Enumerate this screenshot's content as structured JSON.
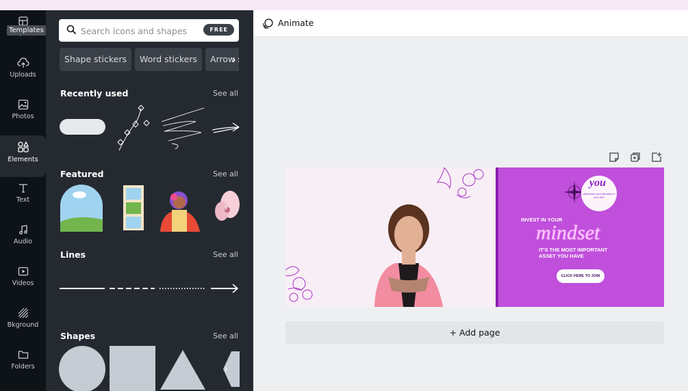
{
  "rail": {
    "tooltip": "Templates",
    "items": [
      {
        "label": "Templates",
        "icon": "templates-icon"
      },
      {
        "label": "Uploads",
        "icon": "cloud-upload-icon"
      },
      {
        "label": "Photos",
        "icon": "photo-icon"
      },
      {
        "label": "Elements",
        "icon": "shapes-icon",
        "active": true
      },
      {
        "label": "Text",
        "icon": "text-icon"
      },
      {
        "label": "Audio",
        "icon": "music-note-icon"
      },
      {
        "label": "Videos",
        "icon": "video-icon"
      },
      {
        "label": "Bkground",
        "icon": "background-icon"
      },
      {
        "label": "Folders",
        "icon": "folder-icon"
      }
    ]
  },
  "panel": {
    "search_placeholder": "Search icons and shapes",
    "free_badge": "FREE",
    "chips": [
      "Shape stickers",
      "Word stickers",
      "Arrow st"
    ],
    "sections": {
      "recent": {
        "title": "Recently used",
        "see_all": "See all"
      },
      "featured": {
        "title": "Featured",
        "see_all": "See all"
      },
      "lines": {
        "title": "Lines",
        "see_all": "See all"
      },
      "shapes": {
        "title": "Shapes",
        "see_all": "See all"
      }
    }
  },
  "toolbar": {
    "animate_label": "Animate"
  },
  "design": {
    "invest": "INVEST IN YOUR",
    "mindset": "mindset",
    "asset_line1": "IT'S THE MOST IMPORTANT",
    "asset_line2": "ASSET YOU HAVE",
    "cta": "CLICK HERE TO JOIN",
    "you": "you",
    "you_sub": "determine your direction in your life!"
  },
  "add_page_label": "+ Add page",
  "colors": {
    "rail_bg": "#0e1318",
    "panel_bg": "#252a31",
    "design_purple": "#c04fdc",
    "canvas_bg": "#edeff1"
  }
}
